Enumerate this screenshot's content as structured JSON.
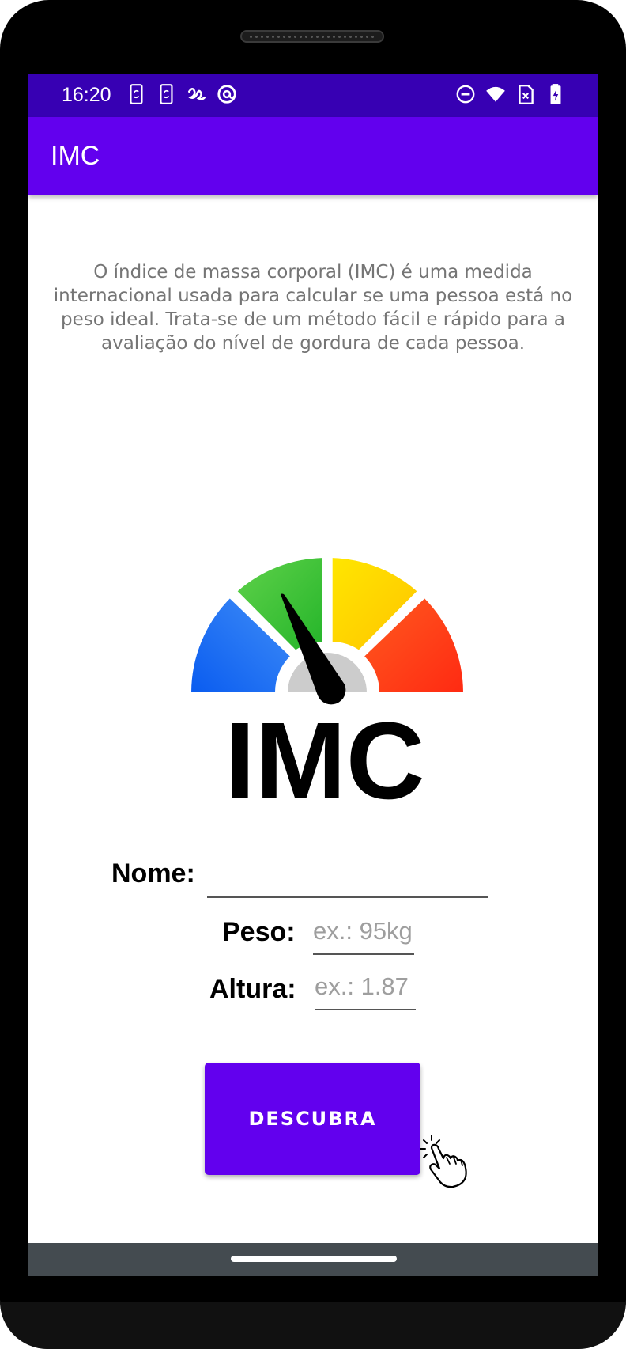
{
  "status_bar": {
    "time": "16:20",
    "left_icons": [
      "sync-phone-icon",
      "sync-phone-icon",
      "scribble-icon",
      "at-sign-icon"
    ],
    "right_icons": [
      "do-not-disturb-icon",
      "wifi-icon",
      "sim-card-icon",
      "battery-charging-icon"
    ]
  },
  "app_bar": {
    "title": "IMC"
  },
  "main": {
    "description": "O índice de massa corporal (IMC) é uma medida internacional usada para calcular se uma pessoa está no peso ideal.  Trata-se de um método fácil e rápido para a avaliação do nível de gordura de cada pessoa.",
    "logo_text": "IMC",
    "gauge_colors": {
      "blue": "#1a6ef5",
      "green": "#3cc43a",
      "yellow": "#ffd400",
      "red": "#ff3d1f",
      "hub": "#cccccc"
    }
  },
  "form": {
    "name_label": "Nome:",
    "name_value": "",
    "weight_label": "Peso:",
    "weight_placeholder": "ex.: 95kg",
    "height_label": "Altura:",
    "height_placeholder": "ex.: 1.87"
  },
  "actions": {
    "submit_label": "DESCUBRA"
  },
  "colors": {
    "primary": "#6200ee",
    "primary_dark": "#3700b3",
    "nav_bar": "#444b50"
  }
}
